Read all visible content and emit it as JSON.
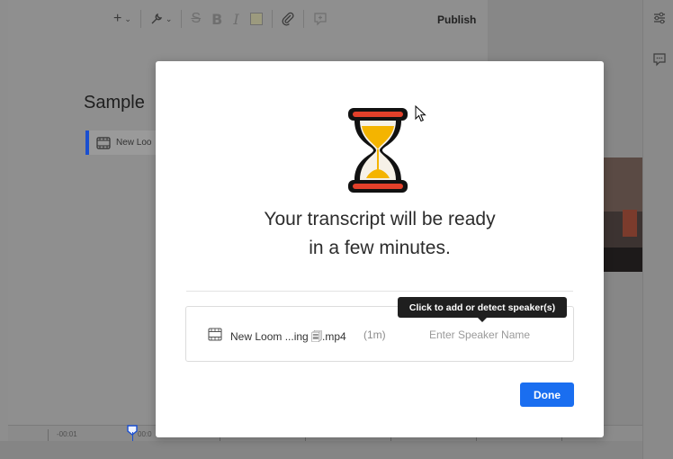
{
  "toolbar": {
    "publish_label": "Publish",
    "icons": [
      "plus-icon",
      "wrench-icon",
      "strikethrough-icon",
      "bold-icon",
      "italic-icon",
      "highlight-icon",
      "attachment-icon",
      "comment-add-icon"
    ],
    "bold_glyph": "B",
    "italic_glyph": "I"
  },
  "document": {
    "title": "Sample",
    "loom_chip_label": "New Loo"
  },
  "timeline": {
    "left_label": "-00:01",
    "playhead_label": "00:0"
  },
  "modal": {
    "title_line1": "Your transcript will be ready",
    "title_line2": "in a few minutes.",
    "file": {
      "name": "New Loom ...ing 🗐.mp4",
      "duration": "(1m)",
      "speaker_placeholder": "Enter Speaker Name",
      "speaker_value": ""
    },
    "tooltip": "Click to add or detect speaker(s)",
    "done_label": "Done"
  },
  "colors": {
    "accent": "#1a6ef0",
    "overlay_gray": "#8e8e8e",
    "hourglass_frame": "#d93a1e",
    "hourglass_sand": "#f4b400"
  }
}
